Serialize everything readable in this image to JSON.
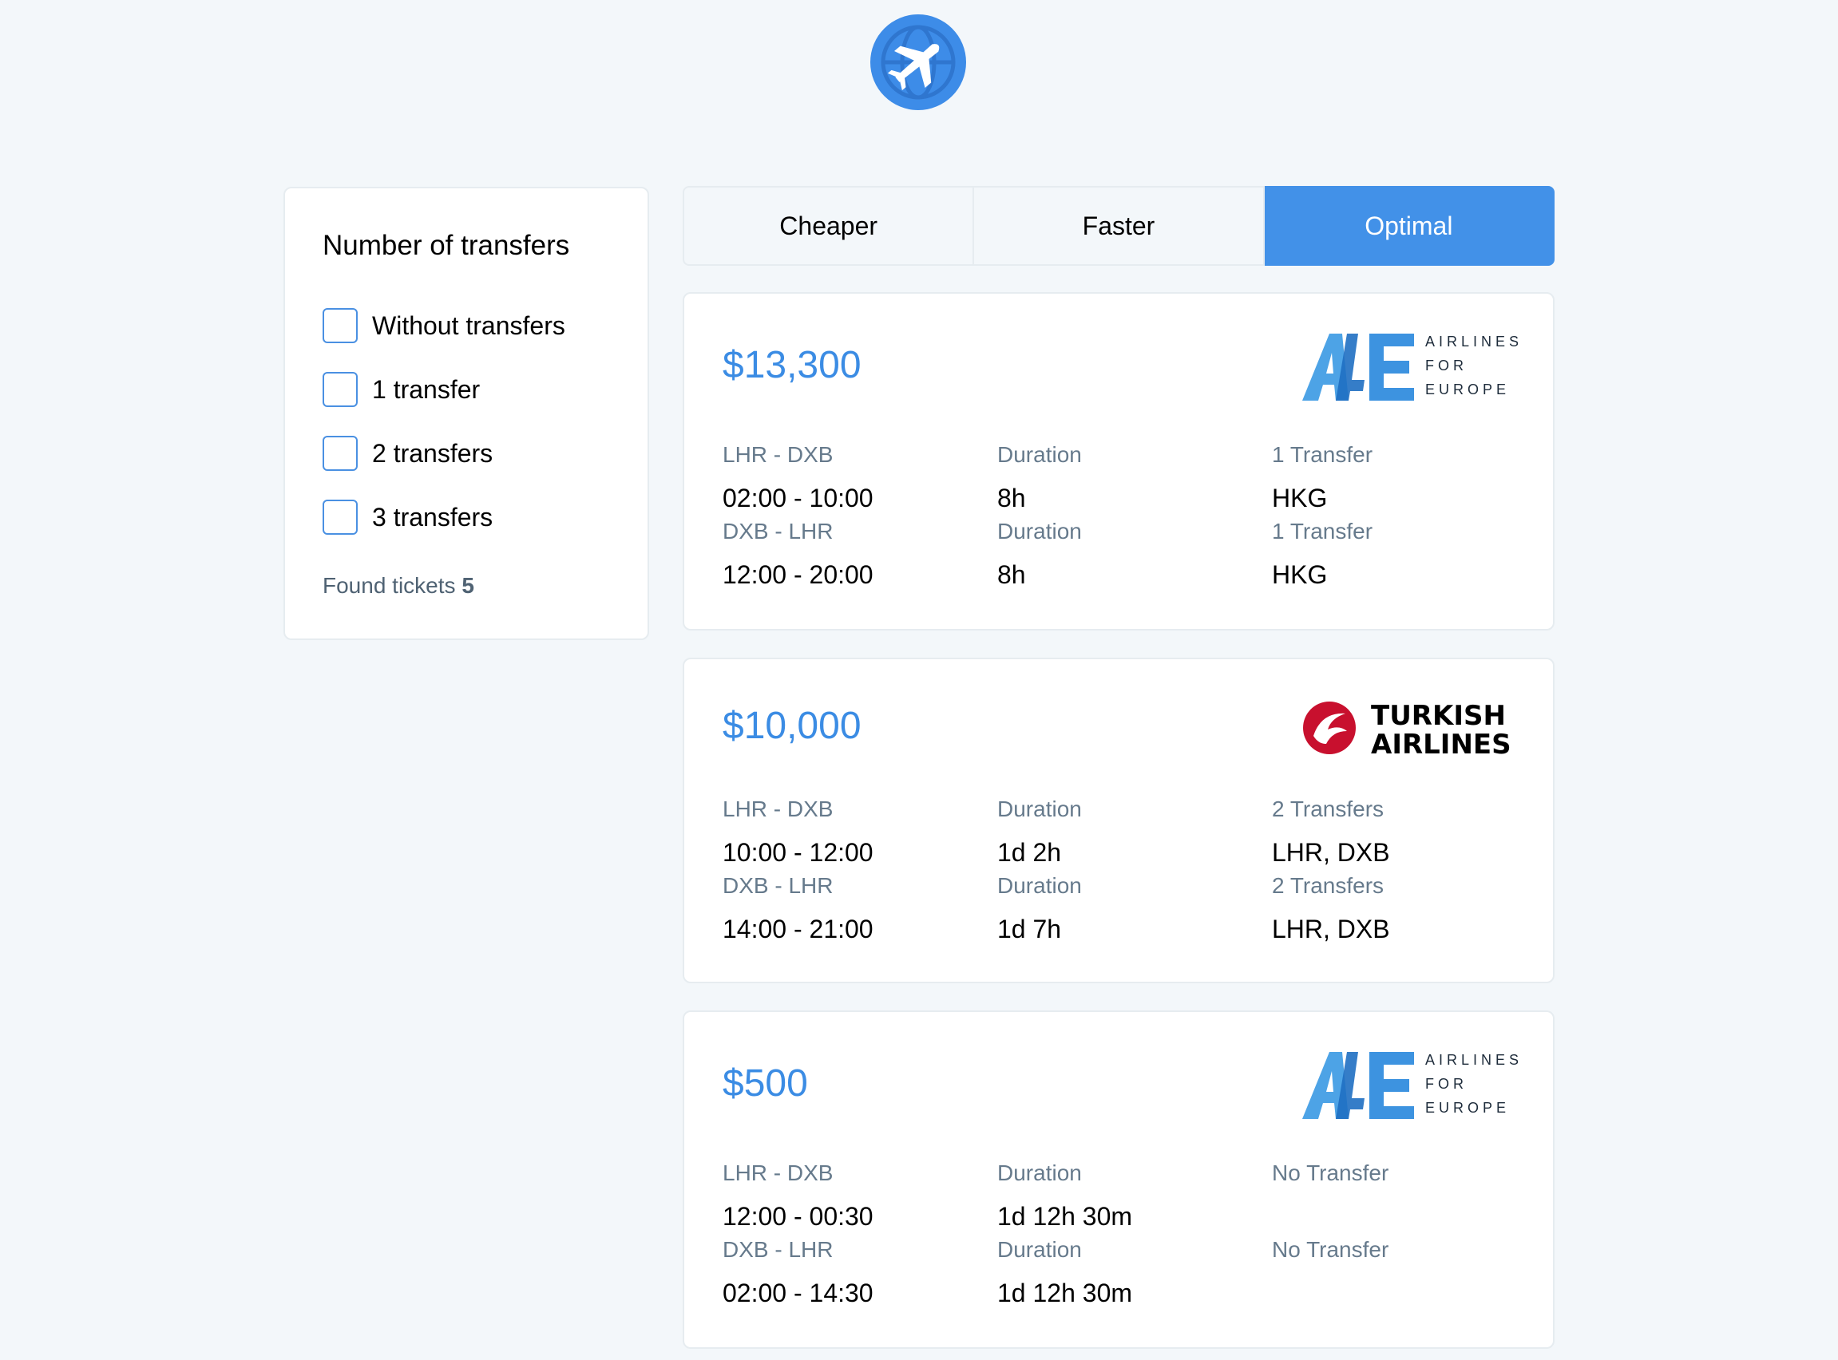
{
  "colors": {
    "accent": "#4291e8",
    "price": "#3b8ce4",
    "background": "#f3f7fa",
    "muted_text": "#667a8c",
    "turkish_red": "#c8102e"
  },
  "app_logo": {
    "icon": "airplane-globe-icon"
  },
  "filter": {
    "title": "Number of transfers",
    "options": [
      {
        "label": "Without transfers",
        "checked": false
      },
      {
        "label": "1 transfer",
        "checked": false
      },
      {
        "label": "2 transfers",
        "checked": false
      },
      {
        "label": "3 transfers",
        "checked": false
      }
    ],
    "found_label": "Found tickets",
    "found_count": "5"
  },
  "tabs": [
    {
      "label": "Cheaper",
      "active": false
    },
    {
      "label": "Faster",
      "active": false
    },
    {
      "label": "Optimal",
      "active": true
    }
  ],
  "tickets": [
    {
      "price": "$13,300",
      "airline": {
        "logo": "a4e-logo",
        "lines": [
          "AIRLINES",
          "FOR",
          "EUROPE"
        ]
      },
      "segments": [
        {
          "route": "LHR - DXB",
          "time": "02:00 - 10:00",
          "duration_label": "Duration",
          "duration": "8h",
          "transfers_label": "1 Transfer",
          "stops": "HKG"
        },
        {
          "route": "DXB - LHR",
          "time": "12:00 - 20:00",
          "duration_label": "Duration",
          "duration": "8h",
          "transfers_label": "1 Transfer",
          "stops": "HKG"
        }
      ]
    },
    {
      "price": "$10,000",
      "airline": {
        "logo": "turkish-airlines-logo",
        "lines": [
          "TURKISH",
          "AIRLINES"
        ]
      },
      "segments": [
        {
          "route": "LHR - DXB",
          "time": "10:00 - 12:00",
          "duration_label": "Duration",
          "duration": "1d 2h",
          "transfers_label": "2 Transfers",
          "stops": "LHR, DXB"
        },
        {
          "route": "DXB - LHR",
          "time": "14:00 - 21:00",
          "duration_label": "Duration",
          "duration": "1d 7h",
          "transfers_label": "2 Transfers",
          "stops": "LHR, DXB"
        }
      ]
    },
    {
      "price": "$500",
      "airline": {
        "logo": "a4e-logo",
        "lines": [
          "AIRLINES",
          "FOR",
          "EUROPE"
        ]
      },
      "segments": [
        {
          "route": "LHR - DXB",
          "time": "12:00 - 00:30",
          "duration_label": "Duration",
          "duration": "1d 12h 30m",
          "transfers_label": "No Transfer",
          "stops": ""
        },
        {
          "route": "DXB - LHR",
          "time": "02:00 - 14:30",
          "duration_label": "Duration",
          "duration": "1d 12h 30m",
          "transfers_label": "No Transfer",
          "stops": ""
        }
      ]
    }
  ]
}
